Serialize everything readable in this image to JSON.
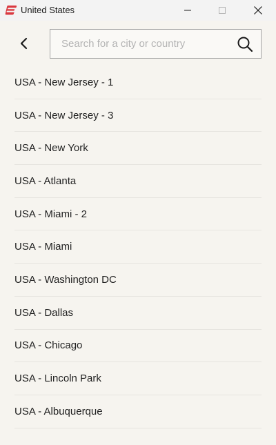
{
  "window": {
    "title": "United States",
    "logo_icon": "expressvpn-logo-icon",
    "controls": [
      "minimize-icon",
      "maximize-icon",
      "close-icon"
    ],
    "accent": "#da3940"
  },
  "header": {
    "back_icon": "chevron-left-icon",
    "search": {
      "placeholder": "Search for a city or country",
      "value": "",
      "icon": "search-icon"
    }
  },
  "locations": [
    "USA - New Jersey - 1",
    "USA - New Jersey - 3",
    "USA - New York",
    "USA - Atlanta",
    "USA - Miami - 2",
    "USA - Miami",
    "USA - Washington DC",
    "USA - Dallas",
    "USA - Chicago",
    "USA - Lincoln Park",
    "USA - Albuquerque"
  ]
}
